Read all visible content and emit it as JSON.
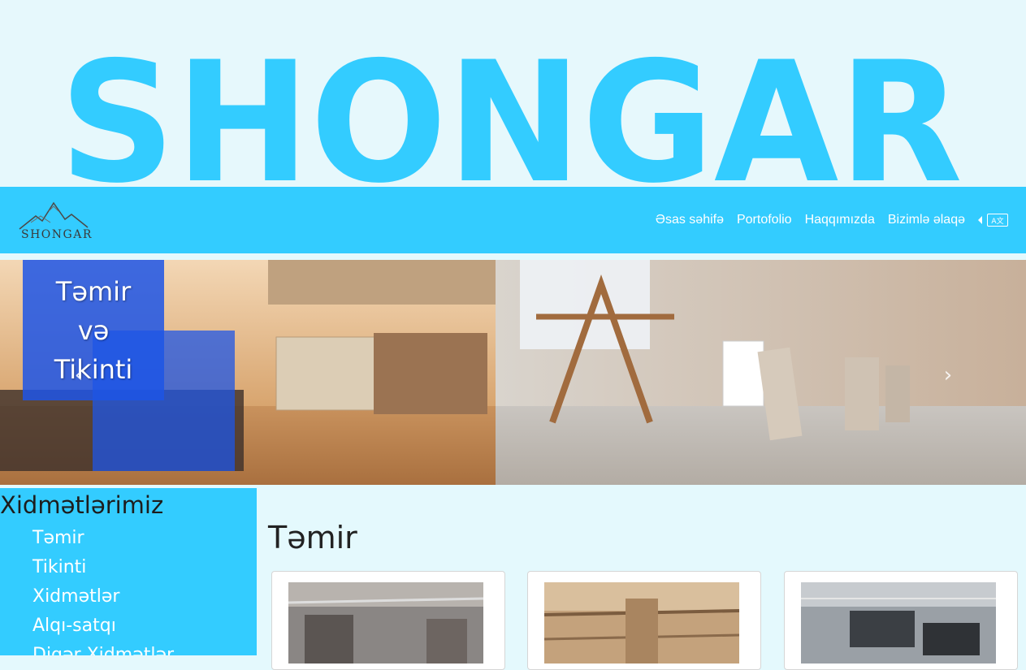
{
  "hero": {
    "logo_text": "SHONGAR"
  },
  "navbar": {
    "brand_text": "SHONGAR",
    "links": [
      {
        "label": "Əsas səhifə"
      },
      {
        "label": "Portofolio"
      },
      {
        "label": "Haqqımızda"
      },
      {
        "label": "Bizimlə əlaqə"
      }
    ],
    "language_icon": "translate-icon"
  },
  "carousel": {
    "caption": [
      "Təmir",
      "və",
      "Tikinti"
    ],
    "prev_icon": "chevron-left-icon",
    "next_icon": "chevron-right-icon"
  },
  "sidebar": {
    "title": "Xidmətlərimiz",
    "items": [
      {
        "label": "Təmir"
      },
      {
        "label": "Tikinti"
      },
      {
        "label": "Xidmətlər"
      },
      {
        "label": "Alqı-satqı"
      },
      {
        "label": "Digər Xidmətlər"
      }
    ]
  },
  "main": {
    "title": "Təmir"
  },
  "colors": {
    "accent": "#33ccff",
    "page_background": "#e4f9fd",
    "logo_color": "#33ccff"
  }
}
